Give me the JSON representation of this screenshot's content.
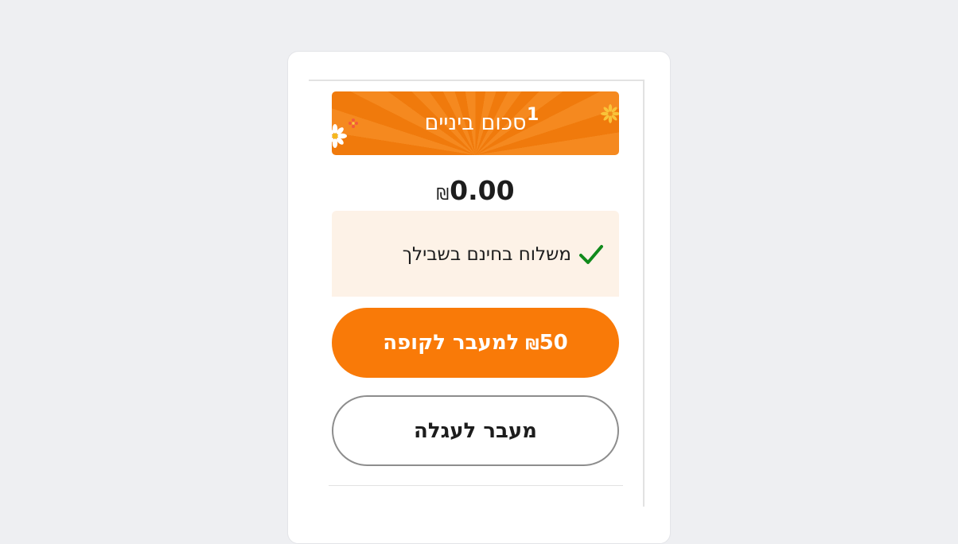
{
  "summary": {
    "subtotal_label": "סכום ביניים",
    "item_count": "1",
    "total_amount": "0.00",
    "currency_symbol": "₪"
  },
  "shipping": {
    "message": "משלוח בחינם בשבילך",
    "status_color": "#118a1c"
  },
  "checkout_button": {
    "amount": "50",
    "currency_symbol": "₪",
    "label": "למעבר לקופה"
  },
  "cart_button": {
    "label": "מעבר לעגלה"
  },
  "colors": {
    "accent": "#f97a08",
    "banner_orange": "#f07a0c",
    "shipping_bg": "#fdf2e7",
    "page_bg": "#eeeff2"
  }
}
